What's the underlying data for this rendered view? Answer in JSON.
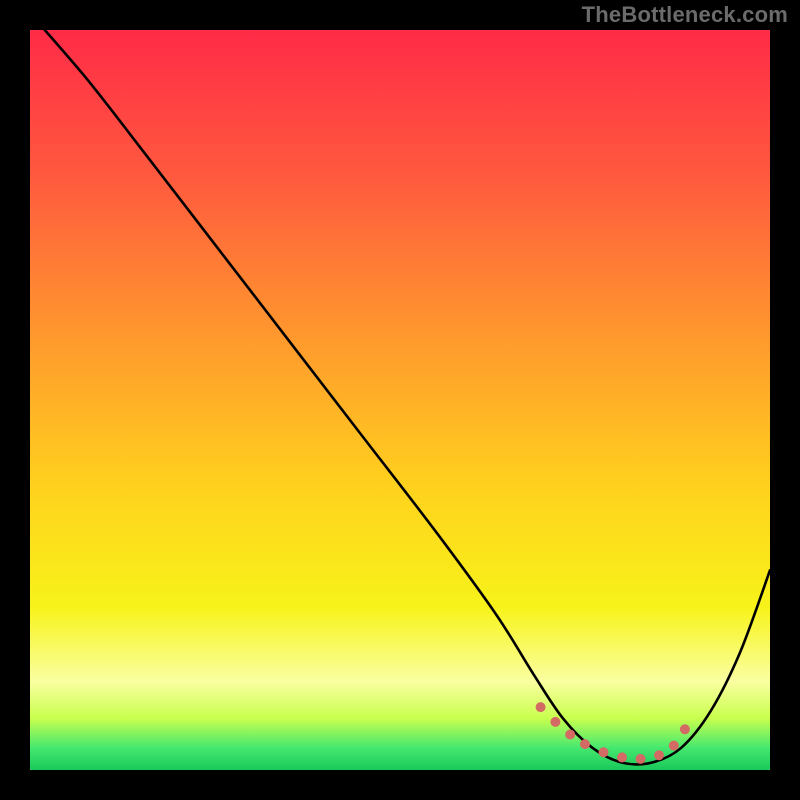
{
  "watermark": "TheBottleneck.com",
  "colors": {
    "background_black": "#000000",
    "curve_stroke": "#000000",
    "marker_fill": "#d36a64",
    "gradient_stops": [
      {
        "offset": "0%",
        "color": "#ff2b47"
      },
      {
        "offset": "20%",
        "color": "#ff5a3e"
      },
      {
        "offset": "42%",
        "color": "#ff9a2d"
      },
      {
        "offset": "62%",
        "color": "#ffd21d"
      },
      {
        "offset": "78%",
        "color": "#f7f31a"
      },
      {
        "offset": "88%",
        "color": "#faffa0"
      },
      {
        "offset": "93%",
        "color": "#c9ff4e"
      },
      {
        "offset": "97%",
        "color": "#46e86f"
      },
      {
        "offset": "100%",
        "color": "#18c95a"
      }
    ]
  },
  "chart_data": {
    "type": "line",
    "title": "",
    "xlabel": "",
    "ylabel": "",
    "xlim": [
      0,
      100
    ],
    "ylim": [
      0,
      100
    ],
    "curve": {
      "x": [
        2,
        8,
        15,
        25,
        35,
        45,
        55,
        63,
        68,
        72,
        76,
        80,
        84,
        88,
        92,
        96,
        100
      ],
      "y": [
        100,
        93,
        84,
        71,
        58,
        45,
        32,
        21,
        13,
        7,
        3,
        1,
        1,
        3,
        8,
        16,
        27
      ]
    },
    "markers": {
      "x": [
        69,
        71,
        73,
        75,
        77.5,
        80,
        82.5,
        85,
        87,
        88.5
      ],
      "y": [
        8.5,
        6.5,
        4.8,
        3.5,
        2.4,
        1.7,
        1.5,
        2.0,
        3.3,
        5.5
      ],
      "radius": 5
    }
  }
}
